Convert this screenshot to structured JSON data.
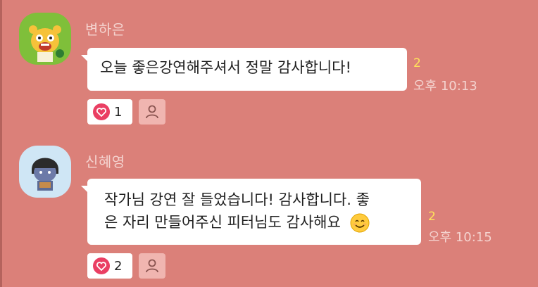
{
  "messages": [
    {
      "sender": "변하은",
      "text": "오늘 좋은강연해주셔서 정말 감사합니다!",
      "unread": "2",
      "time": "오후 10:13",
      "likes": "1",
      "avatar_icon": "ryan-character-icon"
    },
    {
      "sender": "신혜영",
      "text_line1": "작가님 강연 잘 들었습니다! 감사합니다. 좋",
      "text_line2": "은 자리 만들어주신 피터님도 감사해요",
      "unread": "2",
      "time": "오후 10:15",
      "likes": "2",
      "avatar_icon": "character-icon"
    }
  ],
  "colors": {
    "background": "#db8079",
    "heart": "#ea3f63",
    "unread": "#ffe35a"
  }
}
